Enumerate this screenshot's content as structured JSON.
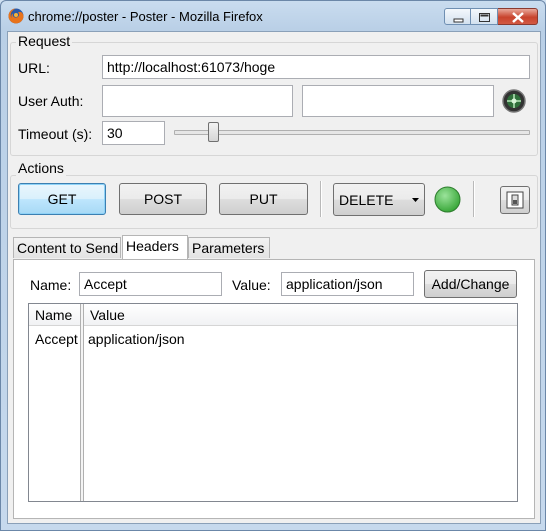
{
  "window": {
    "title": "chrome://poster - Poster - Mozilla Firefox"
  },
  "request": {
    "group_label": "Request",
    "url_label": "URL:",
    "url_value": "http://localhost:61073/hoge",
    "user_auth_label": "User Auth:",
    "user_value": "",
    "password_value": "",
    "timeout_label": "Timeout (s):",
    "timeout_value": "30",
    "timeout_slider_fraction": 0.1
  },
  "actions": {
    "group_label": "Actions",
    "get_label": "GET",
    "post_label": "POST",
    "put_label": "PUT",
    "method_select_value": "DELETE",
    "status_color": "#3aa83a"
  },
  "tabs": [
    {
      "label": "Content to Send",
      "active": false
    },
    {
      "label": "Headers",
      "active": true
    },
    {
      "label": "Parameters",
      "active": false
    }
  ],
  "headers": {
    "name_label": "Name:",
    "name_value": "Accept",
    "value_label": "Value:",
    "value_value": "application/json",
    "add_button_label": "Add/Change",
    "table": {
      "columns": [
        "Name",
        "Value"
      ],
      "rows": [
        {
          "name": "Accept",
          "value": "application/json"
        }
      ]
    }
  }
}
